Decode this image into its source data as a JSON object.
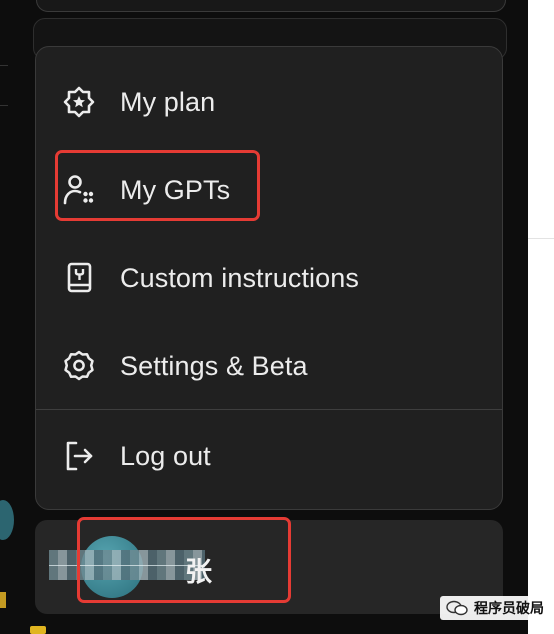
{
  "menu": {
    "items": [
      {
        "label": "My plan",
        "icon": "plan-badge-icon"
      },
      {
        "label": "My GPTs",
        "icon": "gpts-people-icon"
      },
      {
        "label": "Custom instructions",
        "icon": "instructions-book-icon"
      },
      {
        "label": "Settings & Beta",
        "icon": "gear-icon"
      },
      {
        "label": "Log out",
        "icon": "logout-icon"
      }
    ]
  },
  "profile": {
    "name_visible": "张"
  },
  "watermark": {
    "text": "程序员破局"
  },
  "colors": {
    "menu_bg": "#202020",
    "highlight": "#e53b34",
    "text": "#ececec"
  }
}
